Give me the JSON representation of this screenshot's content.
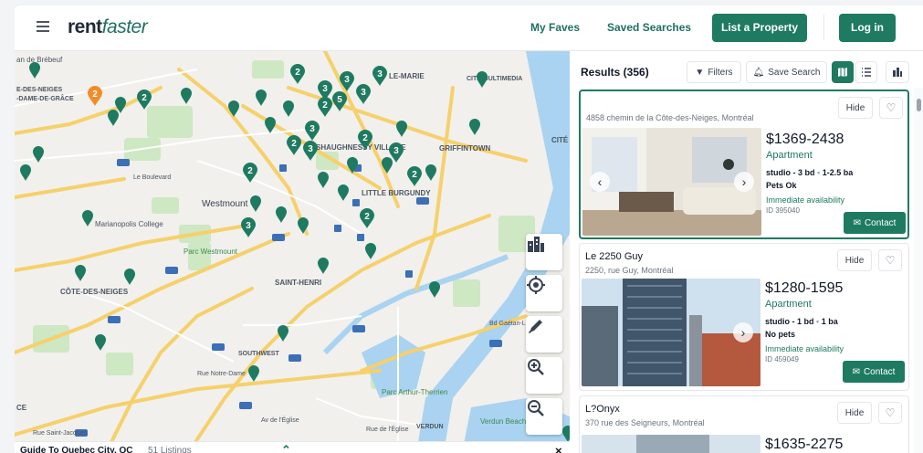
{
  "header": {
    "logo_rent": "rent",
    "logo_faster": "faster",
    "nav_faves": "My Faves",
    "nav_saved": "Saved Searches",
    "list_property": "List a Property",
    "login": "Log in"
  },
  "map": {
    "labels": [
      "Westmount",
      "SAINT-HENRI",
      "CÔTE-DES-NEIGES",
      "GRIFFINTOWN",
      "LITTLE BURGUNDY",
      "SHAUGHNESSY VILLAGE",
      "LE-MARIE",
      "CITÉ MULTIMEDIA",
      "SOUTHWEST",
      "Marianopolis College",
      "Parc Westmount",
      "Parc Arthur-Therrien",
      "VERDUN",
      "Verdun Beach",
      "E-DES-NEIGES",
      "-DAME-DE-GRÂCE",
      "an de Brébeuf",
      "CITÉ",
      "Le Boulevard",
      "Rue Saint-Jacques",
      "Av de l'Église",
      "Rue de l'Église",
      "Rue Notre-Dame",
      "Bd Gaétan-Laberge",
      "CE"
    ],
    "cluster_counts": [
      "2",
      "3",
      "3",
      "2",
      "3",
      "5",
      "3",
      "2",
      "3",
      "3",
      "3",
      "2",
      "2",
      "2",
      "2",
      "3",
      "2"
    ],
    "guide_title": "Guide To Quebec City, QC",
    "guide_count": "51 Listings",
    "guide_expand": "⌃",
    "guide_close": "×",
    "tools": [
      "city-icon",
      "locate-icon",
      "draw-icon",
      "zoom-in-icon",
      "zoom-out-icon"
    ]
  },
  "results": {
    "title": "Results (356)",
    "filters": "Filters",
    "save_search": "Save Search",
    "view_map": "map-view-icon",
    "view_list": "list-view-icon",
    "view_buildings": "building-view-icon",
    "listings": [
      {
        "title": "",
        "address": "4858 chemin de la Côte-des-Neiges, Montréal",
        "hide": "Hide",
        "price": "$1369-2438",
        "type": "Apartment",
        "beds": "studio - 3 bd",
        "baths": "1-2.5 ba",
        "pets": "Pets Ok",
        "availability": "Immediate availability",
        "id": "ID 395040",
        "contact": "Contact"
      },
      {
        "title": "Le 2250 Guy",
        "address": "2250, rue Guy, Montréal",
        "hide": "Hide",
        "price": "$1280-1595",
        "type": "Apartment",
        "beds": "studio - 1 bd",
        "baths": "1 ba",
        "pets": "No pets",
        "availability": "Immediate availability",
        "id": "ID 459049",
        "contact": "Contact"
      },
      {
        "title": "L?Onyx",
        "address": "370 rue des Seigneurs, Montréal",
        "hide": "Hide",
        "price": "$1635-2275"
      }
    ]
  },
  "colors": {
    "brand": "#1e7a61",
    "pin": "#1e7a61",
    "pin_orange": "#f28c28",
    "road_yellow": "#f6d06b",
    "water": "#a9d3f0",
    "park": "#cde8c3"
  }
}
